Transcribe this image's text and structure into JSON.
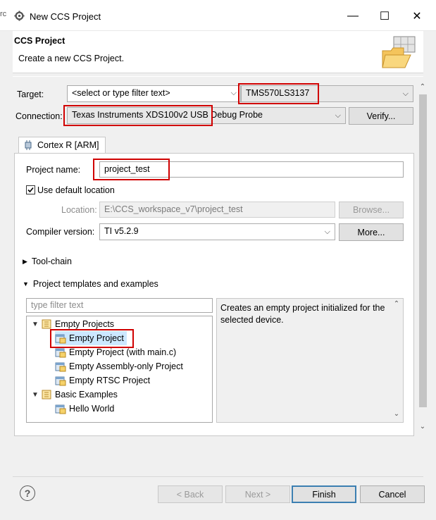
{
  "window": {
    "title": "New CCS Project",
    "bg_fragment": "rc",
    "minimize_glyph": "—",
    "maximize_glyph": "☐",
    "close_glyph": "✕"
  },
  "header": {
    "title": "CCS Project",
    "description": "Create a new CCS Project."
  },
  "target": {
    "label": "Target:",
    "filter_placeholder": "<select or type filter text>",
    "value": "TMS570LS3137"
  },
  "connection": {
    "label": "Connection:",
    "value": "Texas Instruments XDS100v2 USB Debug Probe",
    "verify_label": "Verify..."
  },
  "tab": {
    "label": "Cortex R [ARM]"
  },
  "project": {
    "name_label": "Project name:",
    "name_value": "project_test",
    "use_default_label": "Use default location",
    "use_default_checked": true,
    "location_label": "Location:",
    "location_value": "E:\\CCS_workspace_v7\\project_test",
    "browse_label": "Browse...",
    "compiler_label": "Compiler version:",
    "compiler_value": "TI v5.2.9",
    "more_label": "More..."
  },
  "sections": {
    "toolchain": "Tool-chain",
    "templates": "Project templates and examples"
  },
  "templates": {
    "filter_placeholder": "type filter text",
    "groups": [
      {
        "label": "Empty Projects",
        "items": [
          "Empty Project",
          "Empty Project (with main.c)",
          "Empty Assembly-only Project",
          "Empty RTSC Project"
        ]
      },
      {
        "label": "Basic Examples",
        "items": [
          "Hello World"
        ]
      }
    ],
    "selected": "Empty Project",
    "description": "Creates an empty project initialized for the selected device."
  },
  "footer": {
    "help_glyph": "?",
    "back_label": "< Back",
    "next_label": "Next >",
    "finish_label": "Finish",
    "cancel_label": "Cancel"
  },
  "colors": {
    "highlight": "#d00000",
    "background": "#f0f0f0",
    "default_button_border": "#3c7fb1"
  }
}
